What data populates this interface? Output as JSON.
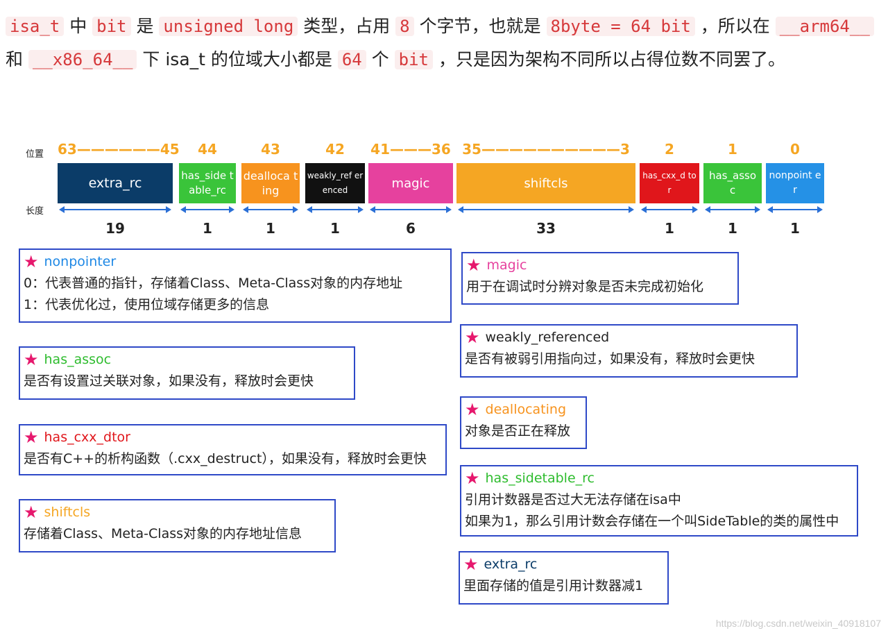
{
  "intro": {
    "c1": "isa_t",
    "t1": " 中 ",
    "c2": "bit",
    "t2": " 是 ",
    "c3": "unsigned long",
    "t3": " 类型，占用 ",
    "c4": "8",
    "t4": " 个字节，也就是 ",
    "c5": "8byte = 64 bit",
    "t5": " ，所以在 ",
    "c6": "__arm64__",
    "t6": " 和 ",
    "c7": "__x86_64__",
    "t7": " 下 isa_t 的位域大小都是 ",
    "c8": "64",
    "t8": " 个 ",
    "c9": "bit",
    "t9": " ，只是因为架构不同所以占得位数不同罢了。"
  },
  "diagram": {
    "position_label": "位置",
    "length_label": "长度",
    "fields": [
      {
        "pos": "63——————45",
        "name": "extra_rc",
        "bits": "19",
        "color": "#0b3c68"
      },
      {
        "pos": "44",
        "name": "has_side table_rc",
        "bits": "1",
        "color": "#3ac43a"
      },
      {
        "pos": "43",
        "name": "dealloca ting",
        "bits": "1",
        "color": "#f7931e"
      },
      {
        "pos": "42",
        "name": "weakly_ref erenced",
        "bits": "1",
        "color": "#111111"
      },
      {
        "pos": "41———36",
        "name": "magic",
        "bits": "6",
        "color": "#e6419e"
      },
      {
        "pos": "35——————————3",
        "name": "shiftcls",
        "bits": "33",
        "color": "#f5a623"
      },
      {
        "pos": "2",
        "name": "has_cxx_d tor",
        "bits": "1",
        "color": "#e0161b"
      },
      {
        "pos": "1",
        "name": "has_asso c",
        "bits": "1",
        "color": "#3ac43a"
      },
      {
        "pos": "0",
        "name": "nonpoint er",
        "bits": "1",
        "color": "#2591e6"
      }
    ]
  },
  "notes": [
    {
      "title": "nonpointer",
      "color": "#1e88e5",
      "lines": [
        "0：代表普通的指针，存储着Class、Meta-Class对象的内存地址",
        "1：代表优化过，使用位域存储更多的信息"
      ]
    },
    {
      "title": "has_assoc",
      "color": "#2ebc2e",
      "lines": [
        "是否有设置过关联对象，如果没有，释放时会更快"
      ]
    },
    {
      "title": "has_cxx_dtor",
      "color": "#e0161b",
      "lines": [
        "是否有C++的析构函数（.cxx_destruct），如果没有，释放时会更快"
      ]
    },
    {
      "title": "shiftcls",
      "color": "#f5a623",
      "lines": [
        "存储着Class、Meta-Class对象的内存地址信息"
      ]
    },
    {
      "title": "magic",
      "color": "#e6419e",
      "lines": [
        "用于在调试时分辨对象是否未完成初始化"
      ]
    },
    {
      "title": "weakly_referenced",
      "color": "#222222",
      "lines": [
        "是否有被弱引用指向过，如果没有，释放时会更快"
      ]
    },
    {
      "title": "deallocating",
      "color": "#f7931e",
      "lines": [
        "对象是否正在释放"
      ]
    },
    {
      "title": "has_sidetable_rc",
      "color": "#2ebc2e",
      "lines": [
        "引用计数器是否过大无法存储在isa中",
        "如果为1，那么引用计数会存储在一个叫SideTable的类的属性中"
      ]
    },
    {
      "title": "extra_rc",
      "color": "#0b3c68",
      "lines": [
        "里面存储的值是引用计数器减1"
      ]
    }
  ],
  "watermark": "https://blog.csdn.net/weixin_40918107"
}
